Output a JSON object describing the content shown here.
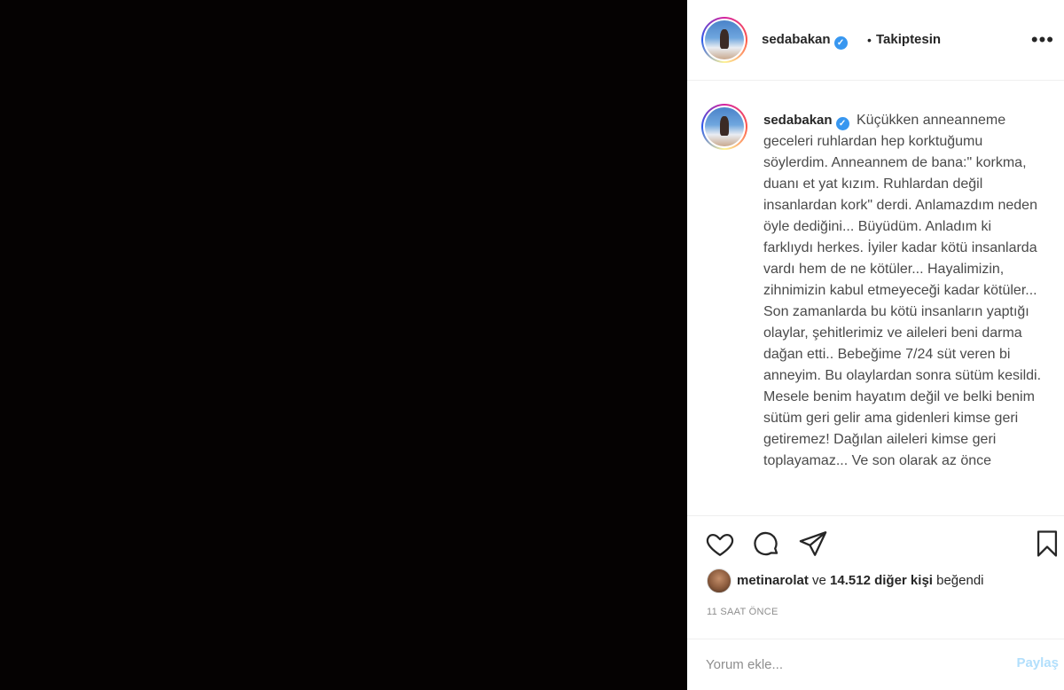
{
  "post": {
    "username": "sedabakan",
    "follow_separator": "•",
    "follow_status": "Takiptesin",
    "more_label": "•••"
  },
  "caption": {
    "username": "sedabakan",
    "text": "Küçükken anneanneme geceleri ruhlardan hep korktuğumu söylerdim. Anneannem de bana:\" korkma, duanı et yat kızım. Ruhlardan değil insanlardan kork\" derdi. Anlamazdım neden öyle dediğini... Büyüdüm. Anladım ki farklıydı herkes. İyiler kadar kötü insanlarda vardı hem de ne kötüler... Hayalimizin, zihnimizin kabul etmeyeceği kadar kötüler... Son zamanlarda bu kötü insanların yaptığı olaylar, şehitlerimiz ve aileleri beni darma dağan etti.. Bebeğime 7/24 süt veren bi anneyim. Bu olaylardan sonra sütüm kesildi. Mesele benim hayatım değil ve belki benim sütüm geri gelir ama gidenleri kimse geri getiremez! Dağılan aileleri kimse geri toplayamaz... Ve son olarak az önce"
  },
  "likes": {
    "liker": "metinarolat",
    "connector": "ve",
    "count_text": "14.512 diğer kişi",
    "suffix": "beğendi"
  },
  "timestamp": "11 SAAT ÖNCE",
  "comment": {
    "placeholder": "Yorum ekle...",
    "share_label": "Paylaş"
  },
  "icons": {
    "like": "heart-icon",
    "comment": "comment-icon",
    "share": "paper-plane-icon",
    "save": "bookmark-icon",
    "verified": "verified-badge-icon"
  },
  "colors": {
    "verified": "#3897f0",
    "share_disabled": "#b2dffc",
    "muted": "#8e8e8e"
  }
}
